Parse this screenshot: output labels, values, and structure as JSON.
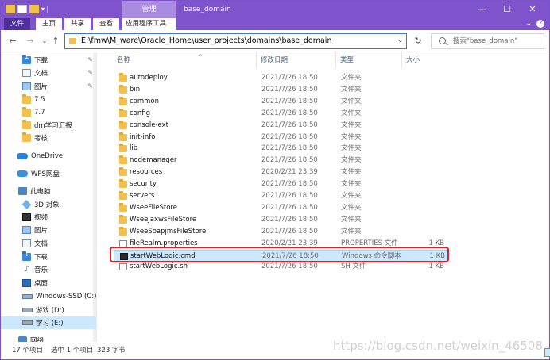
{
  "colors": {
    "accent": "#7f53cc",
    "selection": "#cce8ff",
    "highlight": "#e01f25"
  },
  "titlebar": {
    "contextual_tab": "管理",
    "title": "base_domain",
    "minimize": "—",
    "maximize": "☐",
    "close": "✕"
  },
  "ribbon": {
    "tabs": [
      {
        "label": "文件"
      },
      {
        "label": "主页"
      },
      {
        "label": "共享"
      },
      {
        "label": "查看"
      },
      {
        "label": "应用程序工具"
      }
    ],
    "expand_icon": "chevron-down-icon",
    "help_icon": "help-icon"
  },
  "addressbar": {
    "path": "E:\\fmw\\M_ware\\Oracle_Home\\user_projects\\domains\\base_domain",
    "search_placeholder": "搜索\"base_domain\""
  },
  "sidebar": {
    "items": [
      {
        "label": "下载",
        "icon": "download-folder-icon",
        "pinned": true
      },
      {
        "label": "文档",
        "icon": "documents-icon",
        "pinned": true
      },
      {
        "label": "图片",
        "icon": "pictures-icon",
        "pinned": true
      },
      {
        "label": "7.5",
        "icon": "folder-icon"
      },
      {
        "label": "7.7",
        "icon": "folder-icon"
      },
      {
        "label": "dm学习汇报",
        "icon": "folder-icon"
      },
      {
        "label": "考核",
        "icon": "folder-icon"
      },
      {
        "label": "OneDrive",
        "icon": "onedrive-icon"
      },
      {
        "label": "WPS网盘",
        "icon": "wps-cloud-icon"
      },
      {
        "label": "此电脑",
        "icon": "this-pc-icon"
      },
      {
        "label": "3D 对象",
        "icon": "3d-objects-icon"
      },
      {
        "label": "视频",
        "icon": "videos-icon"
      },
      {
        "label": "图片",
        "icon": "pictures-icon"
      },
      {
        "label": "文档",
        "icon": "documents-icon"
      },
      {
        "label": "下载",
        "icon": "download-folder-icon"
      },
      {
        "label": "音乐",
        "icon": "music-icon"
      },
      {
        "label": "桌面",
        "icon": "desktop-icon"
      },
      {
        "label": "Windows-SSD (C:)",
        "icon": "windows-drive-icon"
      },
      {
        "label": "游戏 (D:)",
        "icon": "drive-icon"
      },
      {
        "label": "学习 (E:)",
        "icon": "drive-icon",
        "selected": true
      },
      {
        "label": "网络",
        "icon": "network-icon"
      }
    ]
  },
  "columns": {
    "name": "名称",
    "date": "修改日期",
    "type": "类型",
    "size": "大小"
  },
  "files": [
    {
      "name": "autodeploy",
      "date": "2021/7/26 18:50",
      "type": "文件夹",
      "size": "",
      "icon": "folder-icon"
    },
    {
      "name": "bin",
      "date": "2021/7/26 18:50",
      "type": "文件夹",
      "size": "",
      "icon": "folder-icon"
    },
    {
      "name": "common",
      "date": "2021/7/26 18:50",
      "type": "文件夹",
      "size": "",
      "icon": "folder-icon"
    },
    {
      "name": "config",
      "date": "2021/7/26 18:50",
      "type": "文件夹",
      "size": "",
      "icon": "folder-icon"
    },
    {
      "name": "console-ext",
      "date": "2021/7/26 18:50",
      "type": "文件夹",
      "size": "",
      "icon": "folder-icon"
    },
    {
      "name": "init-info",
      "date": "2021/7/26 18:50",
      "type": "文件夹",
      "size": "",
      "icon": "folder-icon"
    },
    {
      "name": "lib",
      "date": "2021/7/26 18:50",
      "type": "文件夹",
      "size": "",
      "icon": "folder-icon"
    },
    {
      "name": "nodemanager",
      "date": "2021/7/26 18:50",
      "type": "文件夹",
      "size": "",
      "icon": "folder-icon"
    },
    {
      "name": "resources",
      "date": "2020/2/21 23:39",
      "type": "文件夹",
      "size": "",
      "icon": "folder-icon"
    },
    {
      "name": "security",
      "date": "2021/7/26 18:50",
      "type": "文件夹",
      "size": "",
      "icon": "folder-icon"
    },
    {
      "name": "servers",
      "date": "2021/7/26 18:50",
      "type": "文件夹",
      "size": "",
      "icon": "folder-icon"
    },
    {
      "name": "WseeFileStore",
      "date": "2021/7/26 18:50",
      "type": "文件夹",
      "size": "",
      "icon": "folder-icon"
    },
    {
      "name": "WseeJaxwsFileStore",
      "date": "2021/7/26 18:50",
      "type": "文件夹",
      "size": "",
      "icon": "folder-icon"
    },
    {
      "name": "WseeSoapjmsFileStore",
      "date": "2021/7/26 18:50",
      "type": "文件夹",
      "size": "",
      "icon": "folder-icon"
    },
    {
      "name": "fileRealm.properties",
      "date": "2020/2/21 23:39",
      "type": "PROPERTIES 文件",
      "size": "1 KB",
      "icon": "file-icon"
    },
    {
      "name": "startWebLogic.cmd",
      "date": "2021/7/26 18:50",
      "type": "Windows 命令脚本",
      "size": "1 KB",
      "icon": "cmd-icon",
      "selected": true
    },
    {
      "name": "startWebLogic.sh",
      "date": "2021/7/26 18:50",
      "type": "SH 文件",
      "size": "1 KB",
      "icon": "file-icon"
    }
  ],
  "status": {
    "count": "17 个项目",
    "selection": "选中 1 个项目",
    "size": "323 字节"
  },
  "watermark": "https://blog.csdn.net/weixin_46508"
}
